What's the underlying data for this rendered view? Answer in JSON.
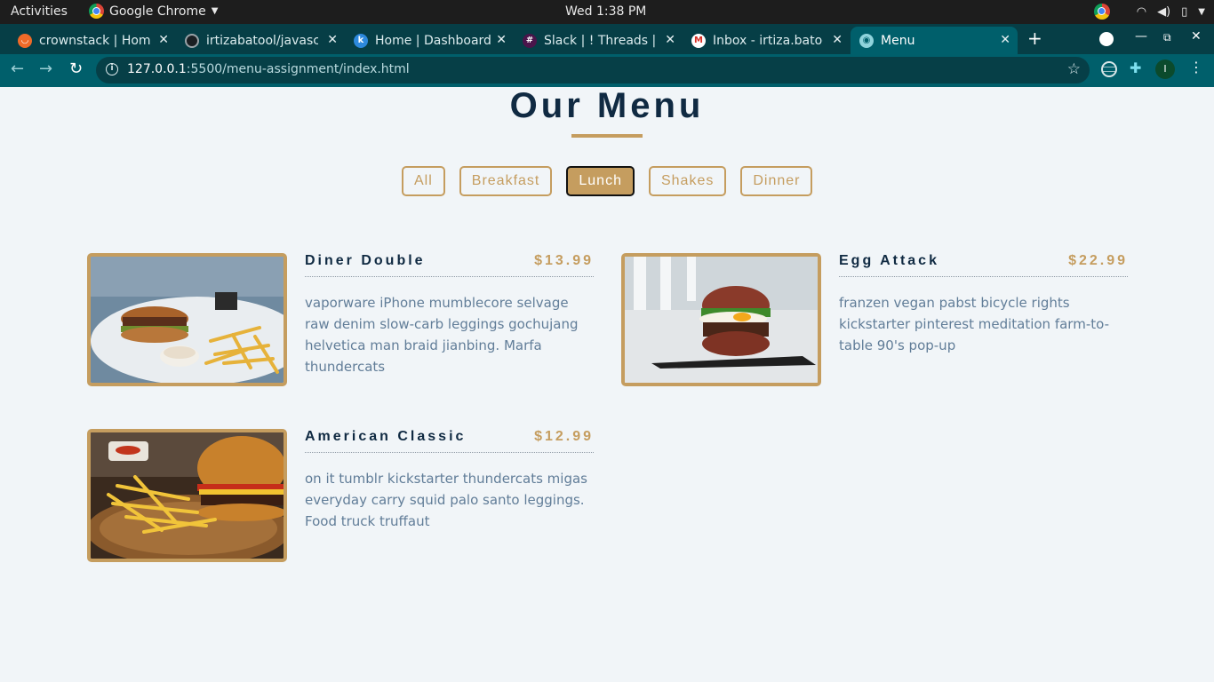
{
  "system_bar": {
    "activities": "Activities",
    "app_name": "Google Chrome",
    "clock": "Wed  1:38 PM"
  },
  "browser": {
    "tabs": [
      {
        "title": "crownstack | Home",
        "favicon": "crownstack-icon",
        "active": false
      },
      {
        "title": "irtizabatool/javascript",
        "favicon": "github-icon",
        "active": false
      },
      {
        "title": "Home | Dashboard",
        "favicon": "k-icon",
        "active": false
      },
      {
        "title": "Slack | ! Threads | c",
        "favicon": "slack-icon",
        "active": false
      },
      {
        "title": "Inbox - irtiza.batool",
        "favicon": "gmail-icon",
        "active": false
      },
      {
        "title": "Menu",
        "favicon": "globe-icon",
        "active": true
      }
    ],
    "url_host": "127.0.0.1",
    "url_rest": ":5500/menu-assignment/index.html",
    "profile_initial": "I"
  },
  "page": {
    "heading": "Our Menu",
    "filters": [
      {
        "label": "All",
        "active": false
      },
      {
        "label": "Breakfast",
        "active": false
      },
      {
        "label": "Lunch",
        "active": true
      },
      {
        "label": "Shakes",
        "active": false
      },
      {
        "label": "Dinner",
        "active": false
      }
    ],
    "items": [
      {
        "name": "Diner Double",
        "price": "$13.99",
        "description": "vaporware iPhone mumblecore selvage raw denim slow-carb leggings gochujang helvetica man braid jianbing. Marfa thundercats"
      },
      {
        "name": "Egg Attack",
        "price": "$22.99",
        "description": "franzen vegan pabst bicycle rights kickstarter pinterest meditation farm-to-table 90's pop-up"
      },
      {
        "name": "American Classic",
        "price": "$12.99",
        "description": "on it tumblr kickstarter thundercats migas everyday carry squid palo santo leggings. Food truck truffaut"
      }
    ]
  },
  "colors": {
    "accent": "#c59d5f",
    "heading": "#102a42",
    "text": "#617d98",
    "background": "#f1f5f8"
  }
}
